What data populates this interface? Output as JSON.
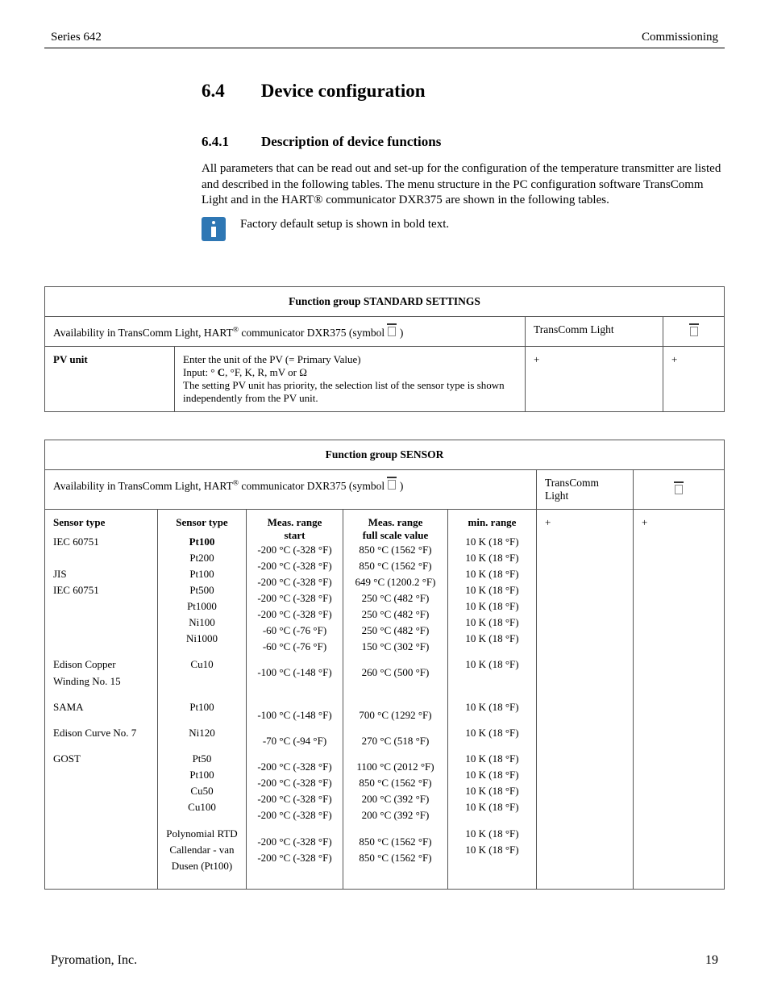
{
  "header": {
    "left": "Series 642",
    "right": "Commissioning"
  },
  "section": {
    "number": "6.4",
    "title": "Device configuration"
  },
  "subsection": {
    "number": "6.4.1",
    "title": "Description of device functions"
  },
  "paragraph": "All parameters that can be read out and set-up for the configuration of the temperature transmitter are listed and described in the following tables. The menu structure in the PC configuration software TransComm Light and in the HART® communicator DXR375 are shown in the following tables.",
  "note": "Factory default setup is shown in bold text.",
  "availability_prefix": "Availability in TransComm Light, HART",
  "availability_suffix": " communicator DXR375 (symbol ",
  "availability_close": " )",
  "transcomm_label": "TransComm Light",
  "table1": {
    "group": "Function group STANDARD SETTINGS",
    "row": {
      "label": "PV unit",
      "line1_a": "Enter the unit of the PV (= Primary Value)",
      "line2_a": "Input: ° ",
      "line2_bold": "C",
      "line2_b": ", °F, K, R, mV or Ω",
      "line3": "The setting PV unit has priority, the selection list of the sensor type is shown independently from the PV unit.",
      "tc": "+",
      "sym": "+"
    }
  },
  "table2": {
    "group": "Function group SENSOR",
    "head": {
      "c1": "Sensor type",
      "c2": "Sensor type",
      "c3a": "Meas. range",
      "c3b": "start",
      "c4a": "Meas. range",
      "c4b": "full scale value",
      "c5": "min. range",
      "c6": "+",
      "c7": "+"
    },
    "blocks": [
      {
        "c1": [
          "IEC 60751",
          "",
          "JIS",
          "IEC 60751",
          "",
          "",
          ""
        ],
        "c2_bold_first": true,
        "c2": [
          "Pt100",
          "Pt200",
          "Pt100",
          "Pt500",
          "Pt1000",
          "Ni100",
          "Ni1000"
        ],
        "c3": [
          "-200 °C (-328 °F)",
          "-200 °C (-328 °F)",
          "-200 °C (-328 °F)",
          "-200 °C (-328 °F)",
          "-200 °C (-328 °F)",
          "-60 °C (-76 °F)",
          "-60 °C (-76 °F)"
        ],
        "c4": [
          "850 °C (1562 °F)",
          "850 °C (1562 °F)",
          "649 °C (1200.2 °F)",
          "250 °C (482 °F)",
          "250 °C (482 °F)",
          "250 °C (482 °F)",
          "150 °C (302 °F)"
        ],
        "c5": [
          "10 K (18 °F)",
          "10 K (18 °F)",
          "10 K (18 °F)",
          "10 K (18 °F)",
          "10 K (18 °F)",
          "10 K (18 °F)",
          "10 K (18 °F)"
        ]
      },
      {
        "c1": [
          "Edison Copper",
          "Winding No. 15"
        ],
        "c2": [
          "Cu10",
          ""
        ],
        "c3": [
          "-100 °C (-148 °F)",
          ""
        ],
        "c4": [
          "260 °C (500 °F)",
          ""
        ],
        "c5": [
          "10 K (18 °F)",
          ""
        ]
      },
      {
        "c1": [
          "SAMA"
        ],
        "c2": [
          "Pt100"
        ],
        "c3": [
          "-100 °C (-148 °F)"
        ],
        "c4": [
          "700 °C (1292 °F)"
        ],
        "c5": [
          "10 K (18 °F)"
        ]
      },
      {
        "c1": [
          "Edison Curve No. 7"
        ],
        "c2": [
          "Ni120"
        ],
        "c3": [
          "-70 °C (-94 °F)"
        ],
        "c4": [
          "270 °C (518 °F)"
        ],
        "c5": [
          "10 K (18 °F)"
        ]
      },
      {
        "c1": [
          "GOST",
          "",
          "",
          ""
        ],
        "c2": [
          "Pt50",
          "Pt100",
          "Cu50",
          "Cu100"
        ],
        "c3": [
          "-200 °C (-328 °F)",
          "-200 °C (-328 °F)",
          "-200 °C (-328 °F)",
          "-200 °C (-328 °F)"
        ],
        "c4": [
          "1100 °C (2012 °F)",
          "850 °C (1562 °F)",
          "200 °C (392 °F)",
          "200 °C (392 °F)"
        ],
        "c5": [
          "10 K (18 °F)",
          "10 K (18 °F)",
          "10 K (18 °F)",
          "10 K (18 °F)"
        ]
      },
      {
        "c1": [
          "",
          "",
          ""
        ],
        "c2": [
          "Polynomial RTD",
          "Callendar - van",
          "Dusen (Pt100)"
        ],
        "c3": [
          "-200 °C (-328 °F)",
          "-200 °C (-328 °F)",
          ""
        ],
        "c4": [
          "850 °C (1562 °F)",
          "850 °C (1562 °F)",
          ""
        ],
        "c5": [
          "10 K (18 °F)",
          "10 K (18 °F)",
          ""
        ]
      }
    ]
  },
  "footer": {
    "left": "Pyromation, Inc.",
    "right": "19"
  }
}
